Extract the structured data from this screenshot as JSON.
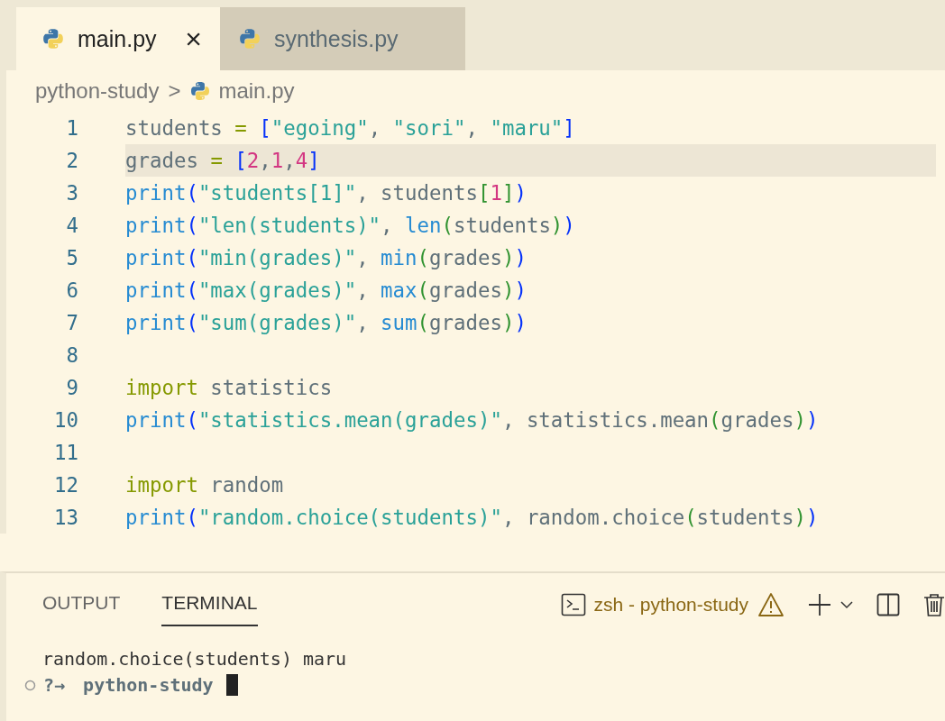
{
  "tabs": [
    {
      "label": "main.py",
      "selected": true,
      "close": "×"
    },
    {
      "label": "synthesis.py",
      "selected": false
    }
  ],
  "breadcrumb": {
    "folder": "python-study",
    "separator": ">",
    "file": "main.py"
  },
  "code": [
    {
      "number": "1",
      "current": false,
      "tokens": [
        {
          "t": "students ",
          "kind": "var"
        },
        {
          "t": "= ",
          "kind": "op"
        },
        {
          "t": "[",
          "kind": "b1"
        },
        {
          "t": "\"egoing\"",
          "kind": "str"
        },
        {
          "t": ", ",
          "kind": "punct"
        },
        {
          "t": "\"sori\"",
          "kind": "str"
        },
        {
          "t": ", ",
          "kind": "punct"
        },
        {
          "t": "\"maru\"",
          "kind": "str"
        },
        {
          "t": "]",
          "kind": "b1"
        }
      ]
    },
    {
      "number": "2",
      "current": true,
      "tokens": [
        {
          "t": "grades ",
          "kind": "var"
        },
        {
          "t": "= ",
          "kind": "op"
        },
        {
          "t": "[",
          "kind": "b1"
        },
        {
          "t": "2",
          "kind": "num"
        },
        {
          "t": ",",
          "kind": "punct"
        },
        {
          "t": "1",
          "kind": "num"
        },
        {
          "t": ",",
          "kind": "punct"
        },
        {
          "t": "4",
          "kind": "num"
        },
        {
          "t": "]",
          "kind": "b1"
        }
      ]
    },
    {
      "number": "3",
      "current": false,
      "tokens": [
        {
          "t": "print",
          "kind": "fn"
        },
        {
          "t": "(",
          "kind": "b1"
        },
        {
          "t": "\"students[1]\"",
          "kind": "str"
        },
        {
          "t": ", ",
          "kind": "punct"
        },
        {
          "t": "students",
          "kind": "var"
        },
        {
          "t": "[",
          "kind": "b2"
        },
        {
          "t": "1",
          "kind": "num"
        },
        {
          "t": "]",
          "kind": "b2"
        },
        {
          "t": ")",
          "kind": "b1"
        }
      ]
    },
    {
      "number": "4",
      "current": false,
      "tokens": [
        {
          "t": "print",
          "kind": "fn"
        },
        {
          "t": "(",
          "kind": "b1"
        },
        {
          "t": "\"len(students)\"",
          "kind": "str"
        },
        {
          "t": ", ",
          "kind": "punct"
        },
        {
          "t": "len",
          "kind": "fn"
        },
        {
          "t": "(",
          "kind": "b2"
        },
        {
          "t": "students",
          "kind": "var"
        },
        {
          "t": ")",
          "kind": "b2"
        },
        {
          "t": ")",
          "kind": "b1"
        }
      ]
    },
    {
      "number": "5",
      "current": false,
      "tokens": [
        {
          "t": "print",
          "kind": "fn"
        },
        {
          "t": "(",
          "kind": "b1"
        },
        {
          "t": "\"min(grades)\"",
          "kind": "str"
        },
        {
          "t": ", ",
          "kind": "punct"
        },
        {
          "t": "min",
          "kind": "fn"
        },
        {
          "t": "(",
          "kind": "b2"
        },
        {
          "t": "grades",
          "kind": "var"
        },
        {
          "t": ")",
          "kind": "b2"
        },
        {
          "t": ")",
          "kind": "b1"
        }
      ]
    },
    {
      "number": "6",
      "current": false,
      "tokens": [
        {
          "t": "print",
          "kind": "fn"
        },
        {
          "t": "(",
          "kind": "b1"
        },
        {
          "t": "\"max(grades)\"",
          "kind": "str"
        },
        {
          "t": ", ",
          "kind": "punct"
        },
        {
          "t": "max",
          "kind": "fn"
        },
        {
          "t": "(",
          "kind": "b2"
        },
        {
          "t": "grades",
          "kind": "var"
        },
        {
          "t": ")",
          "kind": "b2"
        },
        {
          "t": ")",
          "kind": "b1"
        }
      ]
    },
    {
      "number": "7",
      "current": false,
      "tokens": [
        {
          "t": "print",
          "kind": "fn"
        },
        {
          "t": "(",
          "kind": "b1"
        },
        {
          "t": "\"sum(grades)\"",
          "kind": "str"
        },
        {
          "t": ", ",
          "kind": "punct"
        },
        {
          "t": "sum",
          "kind": "fn"
        },
        {
          "t": "(",
          "kind": "b2"
        },
        {
          "t": "grades",
          "kind": "var"
        },
        {
          "t": ")",
          "kind": "b2"
        },
        {
          "t": ")",
          "kind": "b1"
        }
      ]
    },
    {
      "number": "8",
      "current": false
    },
    {
      "number": "9",
      "current": false,
      "tokens": [
        {
          "t": "import",
          "kind": "kw"
        },
        {
          "t": " statistics",
          "kind": "var"
        }
      ]
    },
    {
      "number": "10",
      "current": false,
      "tokens": [
        {
          "t": "print",
          "kind": "fn"
        },
        {
          "t": "(",
          "kind": "b1"
        },
        {
          "t": "\"statistics.mean(grades)\"",
          "kind": "str"
        },
        {
          "t": ", ",
          "kind": "punct"
        },
        {
          "t": "statistics.mean",
          "kind": "var"
        },
        {
          "t": "(",
          "kind": "b2"
        },
        {
          "t": "grades",
          "kind": "var"
        },
        {
          "t": ")",
          "kind": "b2"
        },
        {
          "t": ")",
          "kind": "b1"
        }
      ]
    },
    {
      "number": "11",
      "current": false
    },
    {
      "number": "12",
      "current": false,
      "tokens": [
        {
          "t": "import",
          "kind": "kw"
        },
        {
          "t": " random",
          "kind": "var"
        }
      ]
    },
    {
      "number": "13",
      "current": false,
      "tokens": [
        {
          "t": "print",
          "kind": "fn"
        },
        {
          "t": "(",
          "kind": "b1"
        },
        {
          "t": "\"random.choice(students)\"",
          "kind": "str"
        },
        {
          "t": ", ",
          "kind": "punct"
        },
        {
          "t": "random.choice",
          "kind": "var"
        },
        {
          "t": "(",
          "kind": "b2"
        },
        {
          "t": "students",
          "kind": "var"
        },
        {
          "t": ")",
          "kind": "b2"
        },
        {
          "t": ")",
          "kind": "b1"
        }
      ]
    }
  ],
  "panel": {
    "tabs": [
      {
        "label": "OUTPUT",
        "selected": false
      },
      {
        "label": "TERMINAL",
        "selected": true
      }
    ],
    "terminal_name": "zsh - python-study",
    "lines": [
      "random.choice(students) maru"
    ],
    "prompt": {
      "symbol": "?→",
      "directory": "python-study"
    }
  }
}
